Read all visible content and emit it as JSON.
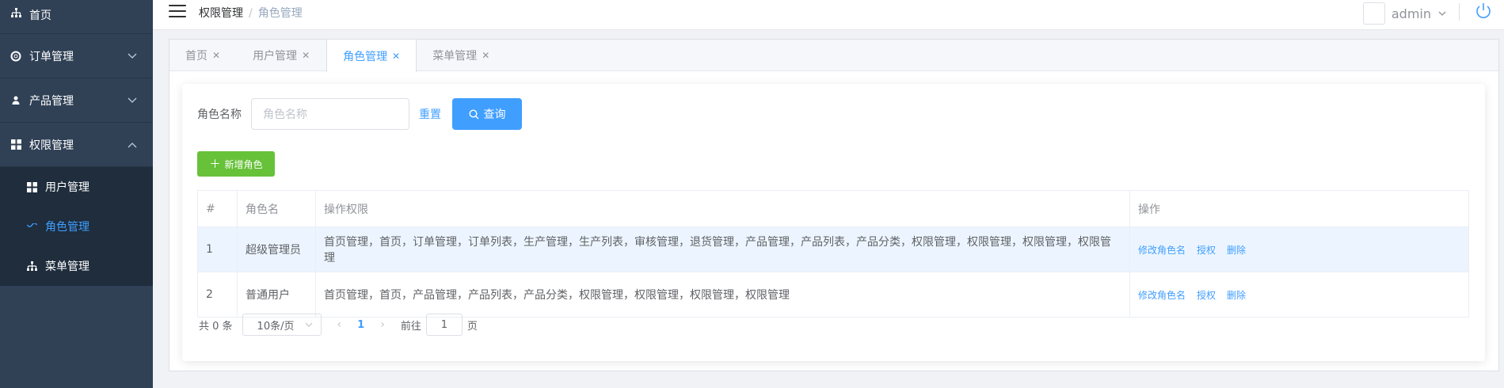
{
  "sidebar": {
    "items": [
      {
        "label": "首页",
        "icon": "sitemap-icon"
      },
      {
        "label": "订单管理",
        "icon": "life-ring-icon"
      },
      {
        "label": "产品管理",
        "icon": "user-icon"
      },
      {
        "label": "权限管理",
        "icon": "grid-icon"
      }
    ],
    "sub_items": [
      {
        "label": "用户管理",
        "icon": "grid-icon"
      },
      {
        "label": "角色管理",
        "icon": "wave-icon"
      },
      {
        "label": "菜单管理",
        "icon": "sitemap-icon"
      }
    ]
  },
  "header": {
    "breadcrumb": [
      "权限管理",
      "角色管理"
    ],
    "separator": "/",
    "user_name": "admin"
  },
  "tabs": [
    {
      "label": "首页"
    },
    {
      "label": "用户管理"
    },
    {
      "label": "角色管理"
    },
    {
      "label": "菜单管理"
    }
  ],
  "search": {
    "label": "角色名称",
    "placeholder": "角色名称",
    "reset_label": "重置",
    "query_label": "查询"
  },
  "add_button_label": "新增角色",
  "table": {
    "headers": [
      "#",
      "角色名",
      "操作权限",
      "操作"
    ],
    "rows": [
      {
        "index": "1",
        "name": "超级管理员",
        "perms": "首页管理，首页，订单管理，订单列表，生产管理，生产列表，审核管理，退货管理，产品管理，产品列表，产品分类，权限管理，权限管理，权限管理，权限管理"
      },
      {
        "index": "2",
        "name": "普通用户",
        "perms": "首页管理，首页，产品管理，产品列表，产品分类，权限管理，权限管理，权限管理，权限管理"
      }
    ],
    "actions": [
      "修改角色名",
      "授权",
      "删除"
    ]
  },
  "pagination": {
    "total": "共 0 条",
    "page_size": "10条/页",
    "current_page": "1",
    "goto_label": "前往",
    "goto_value": "1",
    "page_suffix": "页"
  },
  "colors": {
    "sidebar_bg": "#304156",
    "primary": "#409eff",
    "success": "#67c23a"
  }
}
